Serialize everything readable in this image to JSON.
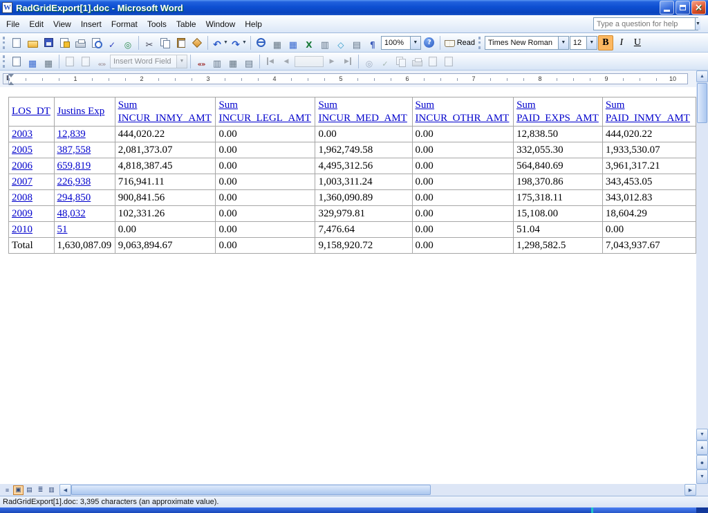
{
  "window": {
    "title": "RadGridExport[1].doc - Microsoft Word",
    "help_placeholder": "Type a question for help"
  },
  "menus": [
    "File",
    "Edit",
    "View",
    "Insert",
    "Format",
    "Tools",
    "Table",
    "Window",
    "Help"
  ],
  "standard_toolbar": {
    "zoom": "100%",
    "read": "Read"
  },
  "formatting_toolbar": {
    "font": "Times New Roman",
    "size": "12",
    "bold": "B",
    "italic": "I",
    "underline": "U"
  },
  "mailmerge_toolbar": {
    "insert_word_field": "Insert Word Field"
  },
  "ruler": [
    "1",
    "2",
    "3",
    "4",
    "5",
    "6",
    "7",
    "8",
    "9",
    "10"
  ],
  "table": {
    "headers": {
      "year": "LOS_DT",
      "exp": "Justins Exp",
      "sums": [
        {
          "top": "Sum",
          "bottom": "INCUR_INMY_AMT"
        },
        {
          "top": "Sum",
          "bottom": "INCUR_LEGL_AMT"
        },
        {
          "top": "Sum",
          "bottom": "INCUR_MED_AMT"
        },
        {
          "top": "Sum",
          "bottom": "INCUR_OTHR_AMT"
        },
        {
          "top": "Sum",
          "bottom": "PAID_EXPS_AMT"
        },
        {
          "top": "Sum",
          "bottom": "PAID_INMY_AMT"
        }
      ]
    },
    "rows": [
      {
        "year": "2003",
        "exp": "12,839",
        "c": [
          "444,020.22",
          "0.00",
          "0.00",
          "0.00",
          "12,838.50",
          "444,020.22"
        ]
      },
      {
        "year": "2005",
        "exp": "387,558",
        "c": [
          "2,081,373.07",
          "0.00",
          "1,962,749.58",
          "0.00",
          "332,055.30",
          "1,933,530.07"
        ]
      },
      {
        "year": "2006",
        "exp": "659,819",
        "c": [
          "4,818,387.45",
          "0.00",
          "4,495,312.56",
          "0.00",
          "564,840.69",
          "3,961,317.21"
        ]
      },
      {
        "year": "2007",
        "exp": "226,938",
        "c": [
          "716,941.11",
          "0.00",
          "1,003,311.24",
          "0.00",
          "198,370.86",
          "343,453.05"
        ]
      },
      {
        "year": "2008",
        "exp": "294,850",
        "c": [
          "900,841.56",
          "0.00",
          "1,360,090.89",
          "0.00",
          "175,318.11",
          "343,012.83"
        ]
      },
      {
        "year": "2009",
        "exp": "48,032",
        "c": [
          "102,331.26",
          "0.00",
          "329,979.81",
          "0.00",
          "15,108.00",
          "18,604.29"
        ]
      },
      {
        "year": "2010",
        "exp": "51",
        "c": [
          "0.00",
          "0.00",
          "7,476.64",
          "0.00",
          "51.04",
          "0.00"
        ]
      }
    ],
    "total": {
      "label": "Total",
      "exp": "1,630,087.09",
      "c": [
        "9,063,894.67",
        "0.00",
        "9,158,920.72",
        "0.00",
        "1,298,582.5",
        "7,043,937.67"
      ]
    }
  },
  "status": {
    "text": "RadGridExport[1].doc: 3,395 characters (an approximate value)."
  }
}
